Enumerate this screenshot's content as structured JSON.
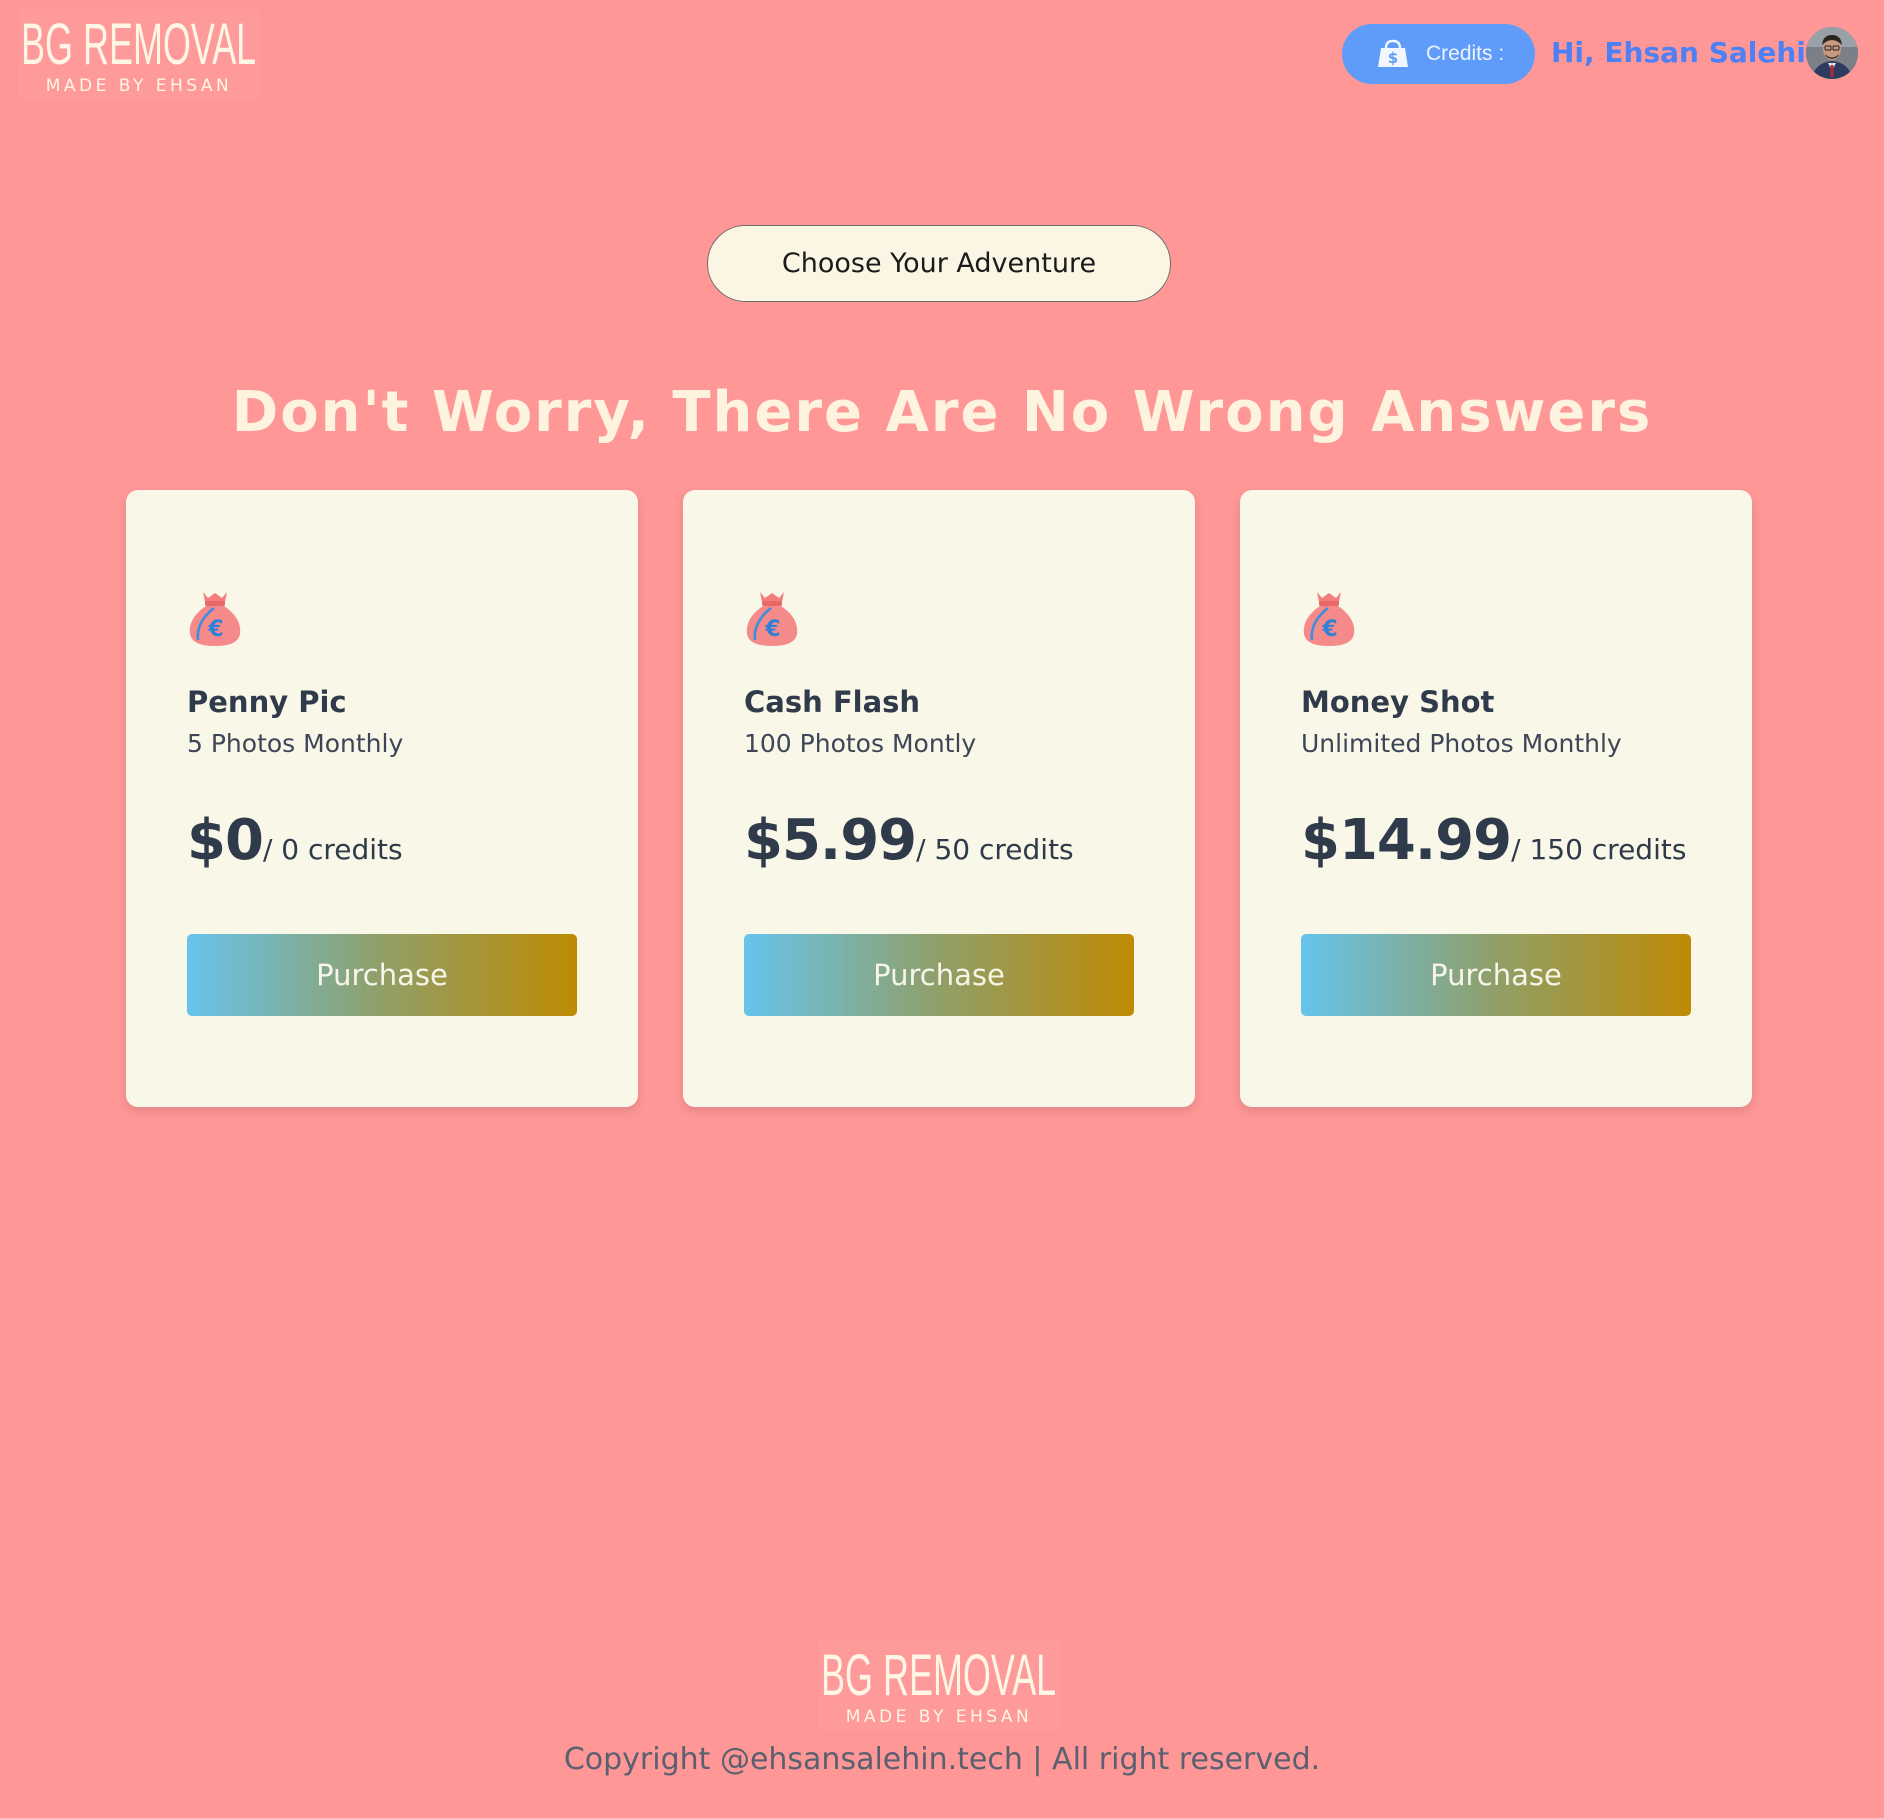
{
  "header": {
    "logo": {
      "main": "BG REMOVAL",
      "sub": "MADE BY EHSAN"
    },
    "credits_label": "Credits :",
    "credits_icon": "shopping-bag-dollar-icon",
    "greeting": "Hi, Ehsan Salehin",
    "avatar_icon": "user-avatar"
  },
  "hero": {
    "pill": "Choose Your Adventure",
    "headline": "Don't Worry, There Are No Wrong Answers"
  },
  "plans": [
    {
      "icon": "money-bag-euro-icon",
      "name": "Penny Pic",
      "desc": "5 Photos Monthly",
      "price": "$0",
      "credits": "/ 0 credits",
      "button": "Purchase"
    },
    {
      "icon": "money-bag-euro-icon",
      "name": "Cash Flash",
      "desc": "100 Photos Montly",
      "price": "$5.99",
      "credits": "/ 50 credits",
      "button": "Purchase"
    },
    {
      "icon": "money-bag-euro-icon",
      "name": "Money Shot",
      "desc": "Unlimited Photos Monthly",
      "price": "$14.99",
      "credits": "/ 150 credits",
      "button": "Purchase"
    }
  ],
  "footer": {
    "logo": {
      "main": "BG REMOVAL",
      "sub": "MADE BY EHSAN"
    },
    "copyright": "Copyright @ehsansalehin.tech | All right reserved."
  },
  "colors": {
    "background": "#ff9797",
    "accent_blue": "#5f9bf8",
    "card": "#f9f7e8",
    "button_gradient_start": "#66c4ec",
    "button_gradient_end": "#be8a04"
  }
}
